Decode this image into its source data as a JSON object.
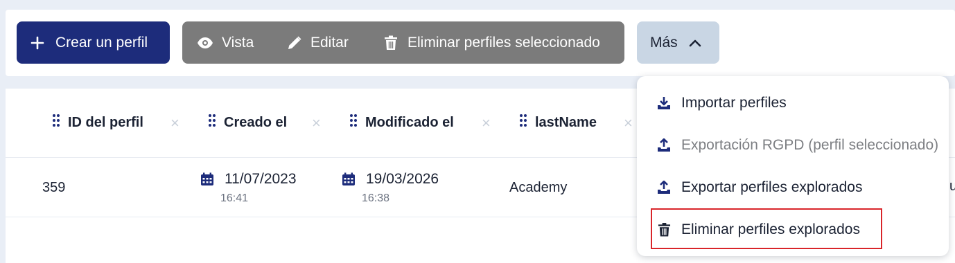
{
  "toolbar": {
    "create_label": "Crear un perfil",
    "view_label": "Vista",
    "edit_label": "Editar",
    "delete_selected_label": "Eliminar perfiles seleccionado",
    "more_label": "Más"
  },
  "table": {
    "columns": [
      "ID del perfil",
      "Creado el",
      "Modificado el",
      "lastName"
    ],
    "rows": [
      {
        "id": "359",
        "created_date": "11/07/2023",
        "created_time": "16:41",
        "modified_date": "19/03/2026",
        "modified_time": "16:38",
        "last_name": "Academy",
        "overflow_text": "u"
      }
    ]
  },
  "more_menu": {
    "items": [
      {
        "label": "Importar perfiles",
        "icon": "download-tray-icon",
        "disabled": false
      },
      {
        "label": "Exportación RGPD (perfil seleccionado)",
        "icon": "upload-tray-icon",
        "disabled": true
      },
      {
        "label": "Exportar perfiles explorados",
        "icon": "upload-tray-icon",
        "disabled": false
      },
      {
        "label": "Eliminar perfiles explorados",
        "icon": "trash-icon",
        "disabled": false,
        "highlighted": true
      }
    ]
  },
  "colors": {
    "primary": "#1d2c7b",
    "group_button": "#7b7b7b",
    "more_button": "#c9d6e4",
    "highlight": "#d9252a",
    "page_bg": "#e9eef6"
  }
}
